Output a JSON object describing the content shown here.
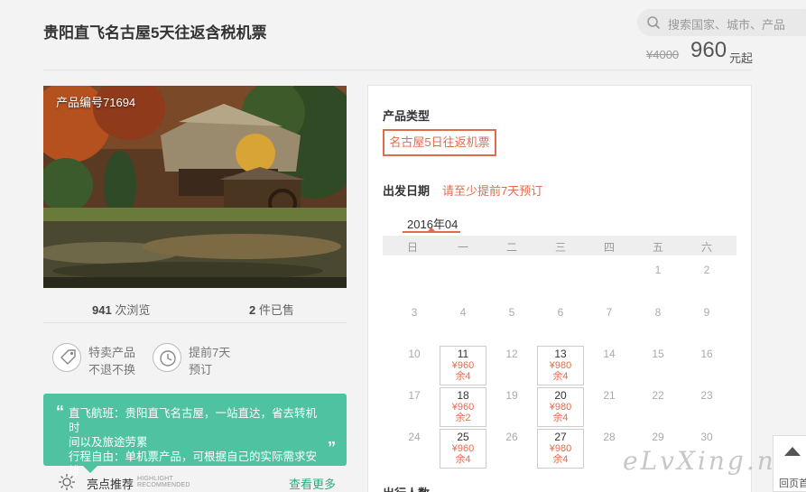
{
  "header": {
    "title": "贵阳直飞名古屋5天往返含税机票",
    "search_placeholder": "搜索国家、城市、产品",
    "price_old": "¥4000",
    "price_now": "960",
    "price_unit": "元起"
  },
  "product": {
    "code": "产品编号71694",
    "views_count": "941",
    "views_label": "次浏览",
    "sold_count": "2",
    "sold_label": "件已售"
  },
  "features": [
    {
      "line1": "特卖产品",
      "line2": "不退不换",
      "icon": "tag-icon"
    },
    {
      "line1": "提前7天",
      "line2": "预订",
      "icon": "clock-icon"
    }
  ],
  "highlight": {
    "line1": "直飞航班：贵阳直飞名古屋，一站直达，省去转机时",
    "line2": "间以及旅途劳累",
    "line3": "行程自由：单机票产品，可根据自己的实际需求安排"
  },
  "recommend": {
    "title": "亮点推荐",
    "en1": "HIGHLIGHT",
    "en2": "RECOMMENDED",
    "more": "查看更多"
  },
  "booking": {
    "type_label": "产品类型",
    "type_option": "名古屋5日往返机票",
    "date_label": "出发日期",
    "date_note": "请至少提前7天预订",
    "month": "2016年04",
    "weekdays": [
      "日",
      "一",
      "二",
      "三",
      "四",
      "五",
      "六"
    ],
    "plain_days": [
      "1",
      "2",
      "3",
      "4",
      "5",
      "6",
      "7",
      "8",
      "9",
      "10",
      "12",
      "14",
      "15",
      "16",
      "17",
      "19",
      "21",
      "22",
      "23",
      "24",
      "26",
      "28",
      "29",
      "30"
    ],
    "available": [
      {
        "day": "11",
        "price": "¥960",
        "remain": "余4"
      },
      {
        "day": "13",
        "price": "¥980",
        "remain": "余4"
      },
      {
        "day": "18",
        "price": "¥960",
        "remain": "余2"
      },
      {
        "day": "20",
        "price": "¥980",
        "remain": "余4"
      },
      {
        "day": "25",
        "price": "¥960",
        "remain": "余4"
      },
      {
        "day": "27",
        "price": "¥980",
        "remain": "余4"
      }
    ],
    "next_label": "出行人数"
  },
  "watermark": "eLvXing.net",
  "back_top": "回页首"
}
